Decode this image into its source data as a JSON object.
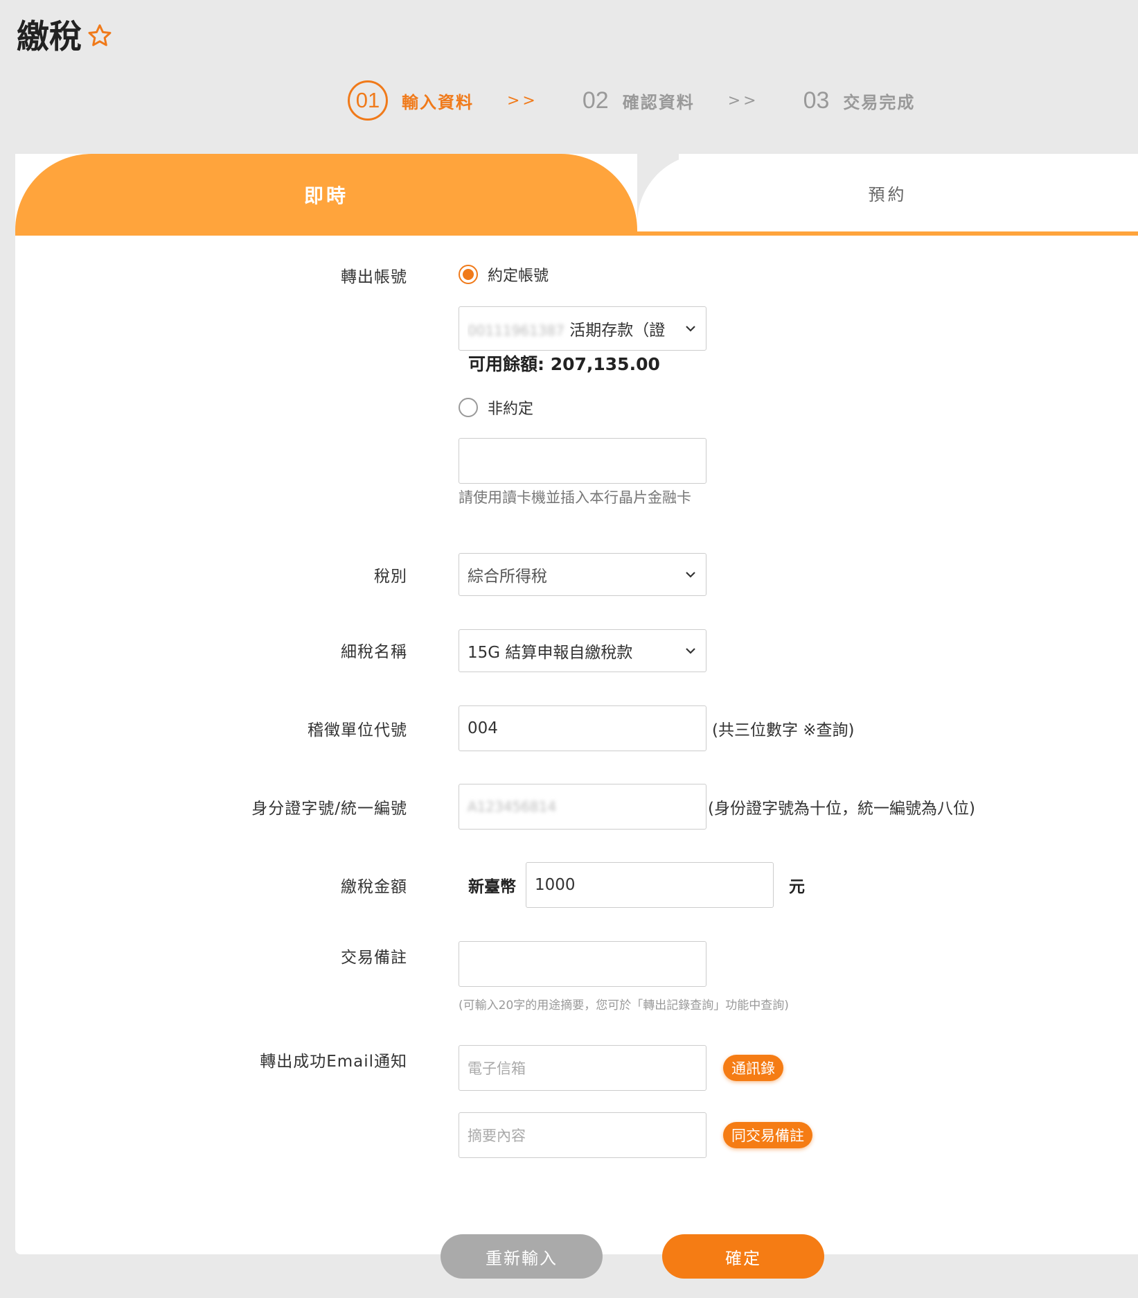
{
  "header": {
    "title": "繳稅"
  },
  "steps": [
    {
      "num": "01",
      "label": "輸入資料"
    },
    {
      "sep": ">>"
    },
    {
      "num": "02",
      "label": "確認資料"
    },
    {
      "sep": ">>"
    },
    {
      "num": "03",
      "label": "交易完成"
    }
  ],
  "tabs": {
    "now": "即時",
    "scheduled": "預約"
  },
  "form": {
    "out_account_label": "轉出帳號",
    "agreed_label": "約定帳號",
    "account_masked": "00111961387",
    "account_type": "活期存款（證",
    "balance": "可用餘額: 207,135.00",
    "non_agreed_label": "非約定",
    "card_hint": "請使用讀卡機並插入本行晶片金融卡",
    "tax_type_label": "稅別",
    "tax_type_value": "綜合所得稅",
    "tax_sub_label": "細稅名稱",
    "tax_sub_value": "15G 結算申報自繳稅款",
    "unit_code_label": "稽徵單位代號",
    "unit_code_value": "004",
    "unit_code_hint": "(共三位數字 ※查詢)",
    "id_label": "身分證字號/統一編號",
    "id_value_masked": "A123456814",
    "id_hint": "(身份證字號為十位，統一編號為八位)",
    "amount_label": "繳稅金額",
    "currency": "新臺幣",
    "amount_value": "1000",
    "amount_unit": "元",
    "memo_label": "交易備註",
    "memo_hint": "(可輸入20字的用途摘要，您可於「轉出記錄查詢」功能中查詢)",
    "email_label": "轉出成功Email通知",
    "email_placeholder": "電子信箱",
    "contacts_button": "通訊錄",
    "summary_placeholder": "摘要內容",
    "same_memo_button": "同交易備註"
  },
  "actions": {
    "reset": "重新輸入",
    "confirm": "確定"
  },
  "colors": {
    "accent": "#f57c14",
    "tab": "#ffa43c"
  }
}
